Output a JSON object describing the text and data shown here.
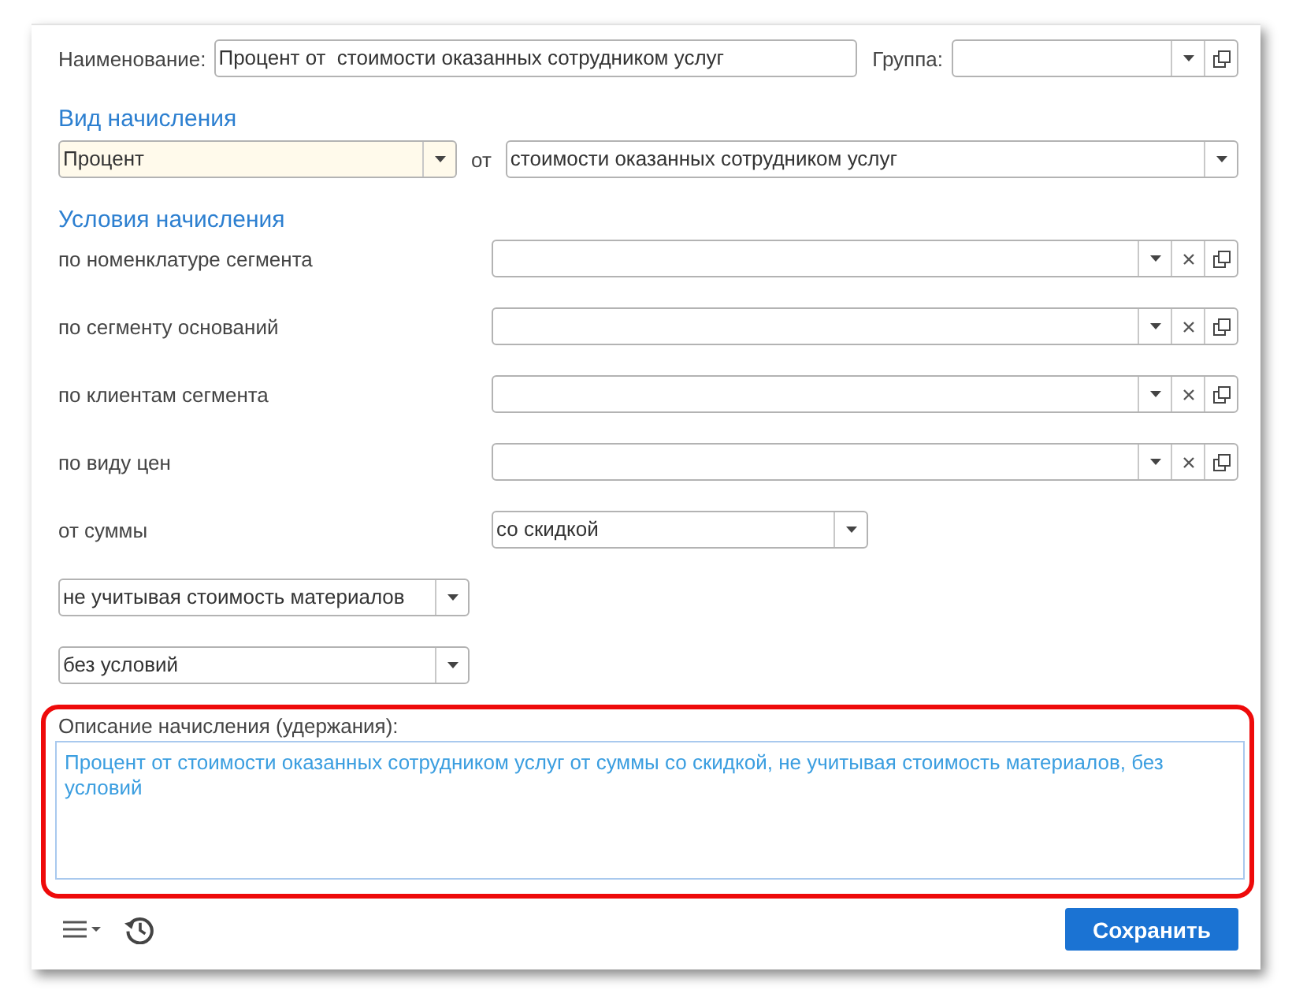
{
  "name_field": {
    "label": "Наименование:",
    "value": "Процент от  стоимости оказанных сотрудником услуг"
  },
  "group_field": {
    "label": "Группа:",
    "kind": "link"
  },
  "accrual_type": {
    "heading": "Вид начисления",
    "kind_field": {
      "kind": "select",
      "value": "Процент",
      "focused": true
    },
    "connector": "от",
    "base_field": {
      "kind": "select",
      "value": "стоимости оказанных сотрудником услуг",
      "focused": false
    }
  },
  "conditions": {
    "heading": "Условия начисления",
    "rows": [
      {
        "label": "по номенклатуре сегмента",
        "kind": "reference"
      },
      {
        "label": "по сегменту оснований",
        "kind": "reference"
      },
      {
        "label": "по клиентам сегмента",
        "kind": "reference"
      },
      {
        "label": "по виду цен",
        "kind": "reference"
      },
      {
        "label": "от суммы",
        "kind": "select",
        "value": "со скидкой"
      }
    ],
    "extra_choices": [
      {
        "kind": "select",
        "value": "не учитывая стоимость материалов"
      },
      {
        "kind": "select",
        "value": "без условий"
      }
    ]
  },
  "description": {
    "label": "Описание начисления (удержания):",
    "value": "Процент от стоимости оказанных сотрудником услуг от суммы со скидкой, не учитывая стоимость материалов, без условий",
    "highlighted": true
  },
  "footer": {
    "save_button": "Сохранить"
  }
}
